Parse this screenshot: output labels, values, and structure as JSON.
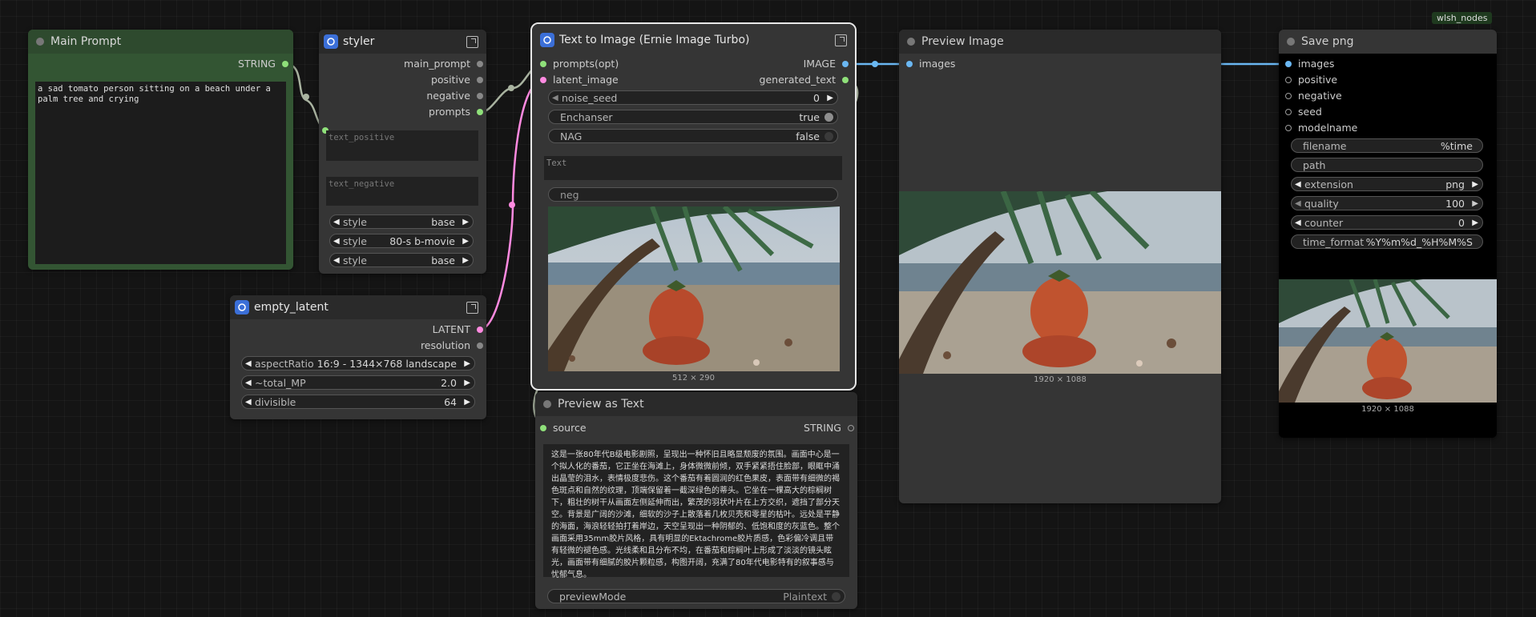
{
  "badge": "wlsh_nodes",
  "main_prompt": {
    "title": "Main Prompt",
    "out": "STRING",
    "text": "a sad tomato person sitting on a beach under a\npalm tree and crying"
  },
  "styler": {
    "title": "styler",
    "outs": [
      "main_prompt",
      "positive",
      "negative",
      "prompts"
    ],
    "text_positive_placeholder": "text_positive",
    "text_negative_placeholder": "text_negative",
    "styles": [
      {
        "label": "style",
        "value": "base"
      },
      {
        "label": "style",
        "value": "80-s b-movie"
      },
      {
        "label": "style",
        "value": "base"
      }
    ]
  },
  "empty_latent": {
    "title": "empty_latent",
    "outs": [
      "LATENT",
      "resolution"
    ],
    "widgets": [
      {
        "label": "aspectRatio",
        "value": "16:9 - 1344×768 landscape"
      },
      {
        "label": "~total_MP",
        "value": "2.0"
      },
      {
        "label": "divisible",
        "value": "64"
      }
    ]
  },
  "t2i": {
    "title": "Text to Image (Ernie Image Turbo)",
    "in_prompts": "prompts(opt)",
    "in_latent": "latent_image",
    "out_image": "IMAGE",
    "out_text": "generated_text",
    "noise_seed_label": "noise_seed",
    "noise_seed_value": "0",
    "enchanser_label": "Enchanser",
    "enchanser_value": "true",
    "nag_label": "NAG",
    "nag_value": "false",
    "text_placeholder": "Text",
    "neg_placeholder": "neg",
    "image_dims": "512 × 290"
  },
  "preview_text": {
    "title": "Preview as Text",
    "in_source": "source",
    "out": "STRING",
    "content": "这是一张80年代B级电影剧照，呈现出一种怀旧且略显颓废的氛围。画面中心是一个拟人化的番茄，它正坐在海滩上，身体微微前倾，双手紧紧捂住脸部，眼眶中涌出晶莹的泪水，表情极度悲伤。这个番茄有着圆润的红色果皮，表面带有细微的褐色斑点和自然的纹理，顶端保留着一截深绿色的蒂头。它坐在一棵高大的棕榈树下，粗壮的树干从画面左侧延伸而出，繁茂的羽状叶片在上方交织，遮挡了部分天空。背景是广阔的沙滩，细软的沙子上散落着几枚贝壳和零星的枯叶。远处是平静的海面，海浪轻轻拍打着岸边，天空呈现出一种阴郁的、低饱和度的灰蓝色。整个画面采用35mm胶片风格，具有明显的Ektachrome胶片质感，色彩偏冷调且带有轻微的褪色感。光线柔和且分布不均，在番茄和棕榈叶上形成了淡淡的镜头眩光，画面带有细腻的胶片颗粒感，构图开阔，充满了80年代电影特有的叙事感与忧郁气息。",
    "mode_label": "previewMode",
    "mode_value": "Plaintext"
  },
  "preview_image": {
    "title": "Preview Image",
    "in_images": "images",
    "dims": "1920 × 1088"
  },
  "save_png": {
    "title": "Save png",
    "ins": [
      "images",
      "positive",
      "negative",
      "seed",
      "modelname"
    ],
    "widgets": [
      {
        "label": "filename",
        "value": "%time"
      },
      {
        "label": "path",
        "value": ""
      },
      {
        "label": "extension",
        "value": "png"
      },
      {
        "label": "quality",
        "value": "100"
      },
      {
        "label": "counter",
        "value": "0"
      },
      {
        "label": "time_format",
        "value": "%Y%m%d_%H%M%S"
      }
    ],
    "dims": "1920 × 1088"
  },
  "colors": {
    "string_link": "#8fe07a",
    "image_link": "#6ab7f2",
    "latent_link": "#ff8ae0",
    "node_bg": "#353535",
    "green_node": "#335533"
  }
}
